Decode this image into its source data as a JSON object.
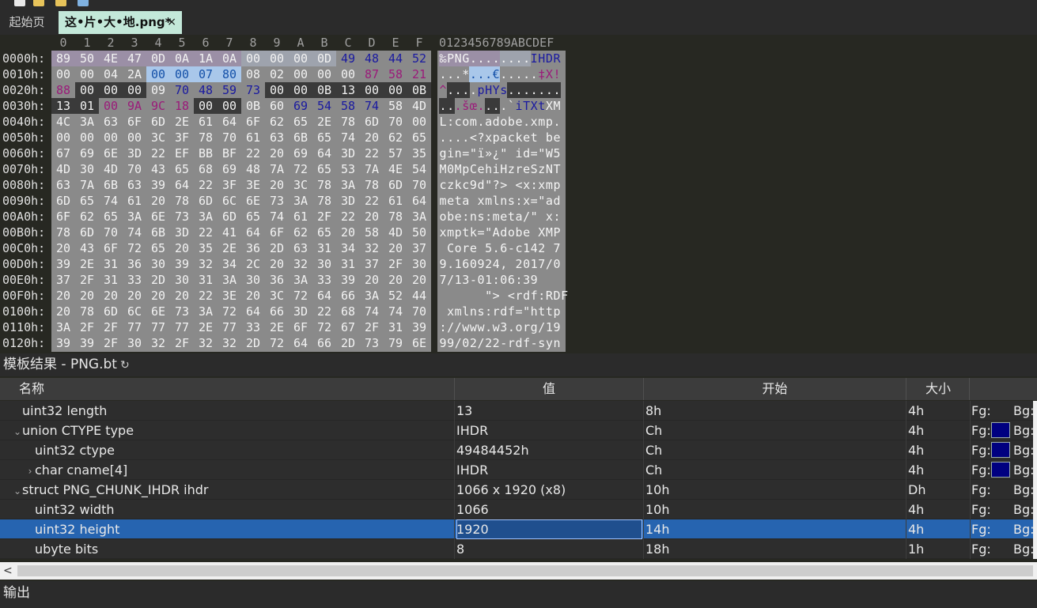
{
  "tabs": {
    "start": "起始页",
    "file": "这•片•大•地.png*",
    "close_glyph": "×"
  },
  "hex": {
    "columns": [
      "0",
      "1",
      "2",
      "3",
      "4",
      "5",
      "6",
      "7",
      "8",
      "9",
      "A",
      "B",
      "C",
      "D",
      "E",
      "F"
    ],
    "ascii_header": "0123456789ABCDEF",
    "rows": [
      {
        "addr": "0000h:",
        "bytes": [
          "89",
          "50",
          "4E",
          "47",
          "0D",
          "0A",
          "1A",
          "0A",
          "00",
          "00",
          "00",
          "0D",
          "49",
          "48",
          "44",
          "52"
        ],
        "ascii": "‰PNG........IHDR"
      },
      {
        "addr": "0010h:",
        "bytes": [
          "00",
          "00",
          "04",
          "2A",
          "00",
          "00",
          "07",
          "80",
          "08",
          "02",
          "00",
          "00",
          "00",
          "87",
          "58",
          "21"
        ],
        "ascii": "...*...€.....‡X!"
      },
      {
        "addr": "0020h:",
        "bytes": [
          "88",
          "00",
          "00",
          "00",
          "09",
          "70",
          "48",
          "59",
          "73",
          "00",
          "00",
          "0B",
          "13",
          "00",
          "00",
          "0B"
        ],
        "ascii": "^....pHYs......."
      },
      {
        "addr": "0030h:",
        "bytes": [
          "13",
          "01",
          "00",
          "9A",
          "9C",
          "18",
          "00",
          "00",
          "0B",
          "60",
          "69",
          "54",
          "58",
          "74",
          "58",
          "4D"
        ],
        "ascii": "...šœ....`iTXtXM"
      },
      {
        "addr": "0040h:",
        "bytes": [
          "4C",
          "3A",
          "63",
          "6F",
          "6D",
          "2E",
          "61",
          "64",
          "6F",
          "62",
          "65",
          "2E",
          "78",
          "6D",
          "70",
          "00"
        ],
        "ascii": "L:com.adobe.xmp."
      },
      {
        "addr": "0050h:",
        "bytes": [
          "00",
          "00",
          "00",
          "00",
          "3C",
          "3F",
          "78",
          "70",
          "61",
          "63",
          "6B",
          "65",
          "74",
          "20",
          "62",
          "65"
        ],
        "ascii": "....<?xpacket be"
      },
      {
        "addr": "0060h:",
        "bytes": [
          "67",
          "69",
          "6E",
          "3D",
          "22",
          "EF",
          "BB",
          "BF",
          "22",
          "20",
          "69",
          "64",
          "3D",
          "22",
          "57",
          "35"
        ],
        "ascii": "gin=\"ï»¿\" id=\"W5"
      },
      {
        "addr": "0070h:",
        "bytes": [
          "4D",
          "30",
          "4D",
          "70",
          "43",
          "65",
          "68",
          "69",
          "48",
          "7A",
          "72",
          "65",
          "53",
          "7A",
          "4E",
          "54"
        ],
        "ascii": "M0MpCehiHzreSzNT"
      },
      {
        "addr": "0080h:",
        "bytes": [
          "63",
          "7A",
          "6B",
          "63",
          "39",
          "64",
          "22",
          "3F",
          "3E",
          "20",
          "3C",
          "78",
          "3A",
          "78",
          "6D",
          "70"
        ],
        "ascii": "czkc9d\"?> <x:xmp"
      },
      {
        "addr": "0090h:",
        "bytes": [
          "6D",
          "65",
          "74",
          "61",
          "20",
          "78",
          "6D",
          "6C",
          "6E",
          "73",
          "3A",
          "78",
          "3D",
          "22",
          "61",
          "64"
        ],
        "ascii": "meta xmlns:x=\"ad"
      },
      {
        "addr": "00A0h:",
        "bytes": [
          "6F",
          "62",
          "65",
          "3A",
          "6E",
          "73",
          "3A",
          "6D",
          "65",
          "74",
          "61",
          "2F",
          "22",
          "20",
          "78",
          "3A"
        ],
        "ascii": "obe:ns:meta/\" x:"
      },
      {
        "addr": "00B0h:",
        "bytes": [
          "78",
          "6D",
          "70",
          "74",
          "6B",
          "3D",
          "22",
          "41",
          "64",
          "6F",
          "62",
          "65",
          "20",
          "58",
          "4D",
          "50"
        ],
        "ascii": "xmptk=\"Adobe XMP"
      },
      {
        "addr": "00C0h:",
        "bytes": [
          "20",
          "43",
          "6F",
          "72",
          "65",
          "20",
          "35",
          "2E",
          "36",
          "2D",
          "63",
          "31",
          "34",
          "32",
          "20",
          "37"
        ],
        "ascii": " Core 5.6-c142 7"
      },
      {
        "addr": "00D0h:",
        "bytes": [
          "39",
          "2E",
          "31",
          "36",
          "30",
          "39",
          "32",
          "34",
          "2C",
          "20",
          "32",
          "30",
          "31",
          "37",
          "2F",
          "30"
        ],
        "ascii": "9.160924, 2017/0"
      },
      {
        "addr": "00E0h:",
        "bytes": [
          "37",
          "2F",
          "31",
          "33",
          "2D",
          "30",
          "31",
          "3A",
          "30",
          "36",
          "3A",
          "33",
          "39",
          "20",
          "20",
          "20"
        ],
        "ascii": "7/13-01:06:39   "
      },
      {
        "addr": "00F0h:",
        "bytes": [
          "20",
          "20",
          "20",
          "20",
          "20",
          "20",
          "22",
          "3E",
          "20",
          "3C",
          "72",
          "64",
          "66",
          "3A",
          "52",
          "44",
          "46"
        ],
        "ascii": "      \"> <rdf:RDF"
      },
      {
        "addr": "0100h:",
        "bytes": [
          "20",
          "78",
          "6D",
          "6C",
          "6E",
          "73",
          "3A",
          "72",
          "64",
          "66",
          "3D",
          "22",
          "68",
          "74",
          "74",
          "70"
        ],
        "ascii": " xmlns:rdf=\"http"
      },
      {
        "addr": "0110h:",
        "bytes": [
          "3A",
          "2F",
          "2F",
          "77",
          "77",
          "77",
          "2E",
          "77",
          "33",
          "2E",
          "6F",
          "72",
          "67",
          "2F",
          "31",
          "39"
        ],
        "ascii": "://www.w3.org/19"
      },
      {
        "addr": "0120h:",
        "bytes": [
          "39",
          "39",
          "2F",
          "30",
          "32",
          "2F",
          "32",
          "32",
          "2D",
          "72",
          "64",
          "66",
          "2D",
          "73",
          "79",
          "6E"
        ],
        "ascii": "99/02/22-rdf-syn"
      }
    ]
  },
  "template": {
    "title": "模板结果 - PNG.bt",
    "headers": {
      "name": "名称",
      "value": "值",
      "start": "开始",
      "size": "大小"
    },
    "rows": [
      {
        "name": "uint32 length",
        "value": "13",
        "start": "8h",
        "size": "4h",
        "fg": "Fg:",
        "bg": "Bg:",
        "indent": 1,
        "chevron": "",
        "swatch": false,
        "selected": false
      },
      {
        "name": "union CTYPE type",
        "value": "IHDR",
        "start": "Ch",
        "size": "4h",
        "fg": "Fg:",
        "bg": "Bg:",
        "indent": 1,
        "chevron": "expanded",
        "swatch": true,
        "selected": false
      },
      {
        "name": "uint32 ctype",
        "value": "49484452h",
        "start": "Ch",
        "size": "4h",
        "fg": "Fg:",
        "bg": "Bg:",
        "indent": 2,
        "chevron": "",
        "swatch": true,
        "selected": false
      },
      {
        "name": "char cname[4]",
        "value": "IHDR",
        "start": "Ch",
        "size": "4h",
        "fg": "Fg:",
        "bg": "Bg:",
        "indent": 2,
        "chevron": "collapsed",
        "swatch": true,
        "selected": false
      },
      {
        "name": "struct PNG_CHUNK_IHDR ihdr",
        "value": "1066 x 1920 (x8)",
        "start": "10h",
        "size": "Dh",
        "fg": "Fg:",
        "bg": "Bg:",
        "indent": 1,
        "chevron": "expanded",
        "swatch": false,
        "selected": false
      },
      {
        "name": "uint32 width",
        "value": "1066",
        "start": "10h",
        "size": "4h",
        "fg": "Fg:",
        "bg": "Bg:",
        "indent": 2,
        "chevron": "",
        "swatch": false,
        "selected": false
      },
      {
        "name": "uint32 height",
        "value": "1920",
        "start": "14h",
        "size": "4h",
        "fg": "Fg:",
        "bg": "Bg:",
        "indent": 2,
        "chevron": "",
        "swatch": false,
        "selected": true
      },
      {
        "name": "ubyte bits",
        "value": "8",
        "start": "18h",
        "size": "1h",
        "fg": "Fg:",
        "bg": "Bg:",
        "indent": 2,
        "chevron": "",
        "swatch": false,
        "selected": false
      }
    ]
  },
  "output": {
    "title": "输出"
  },
  "colors": {
    "signature_bg": "#9b8fa6",
    "ihdr_text": "#1a1aa0",
    "chunk_len_bg": "#9ea3ad",
    "dim_bg": "#a9c7ea",
    "dim_text": "#1450a8",
    "crc_text": "#9b1b7a",
    "phys_bg": "#3a3a3a",
    "selection_blue": "#2664b0"
  }
}
